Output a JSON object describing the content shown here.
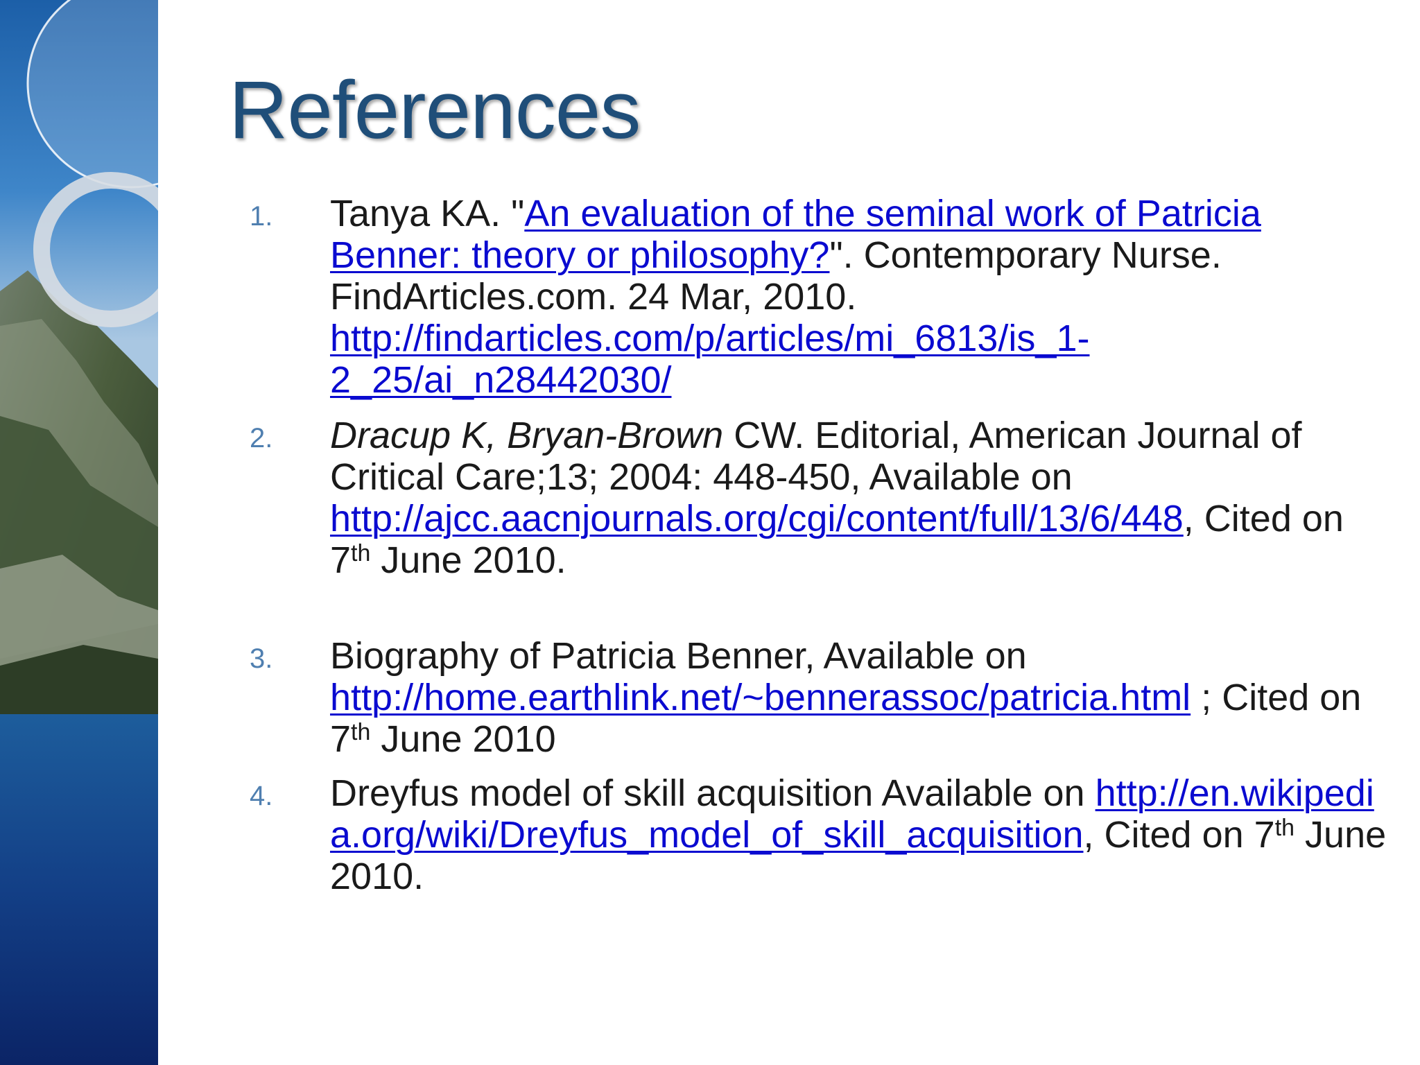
{
  "title": "References",
  "references": [
    {
      "number": "1.",
      "pre": "Tanya KA. \"",
      "link_title": "An evaluation of the seminal work of Patricia Benner: theory or philosophy?",
      "mid": "\". Contemporary Nurse. FindArticles.com. 24 Mar, 2010. ",
      "url": "http://findarticles.com/p/articles/mi_6813/is_1-2_25/ai_n28442030/"
    },
    {
      "number": "2.",
      "authors_italic": "Dracup K, Bryan-Brown",
      "text": " CW. Editorial, American Journal of Critical Care;13; 2004: 448-450,  Available on ",
      "url": "http://ajcc.aacnjournals.org/cgi/content/full/13/6/448",
      "after_url": ", Cited on 7",
      "sup": "th",
      "tail": " June 2010."
    },
    {
      "number": "3.",
      "text": "Biography of Patricia Benner, Available on ",
      "url": "http://home.earthlink.net/~bennerassoc/patricia.html",
      "after_url": " ; Cited on 7",
      "sup": "th",
      "tail": " June 2010"
    },
    {
      "number": "4.",
      "text": "Dreyfus model of skill acquisition Available on ",
      "url": "http://en.wikipedia.org/wiki/Dreyfus_model_of_skill_acquisition",
      "after_url": ", Cited on 7",
      "sup": "th",
      "tail": " June 2010."
    }
  ],
  "colors": {
    "title": "#1f4e79",
    "link": "#0a0ad0",
    "number": "#4f7fb0",
    "body_text": "#1a1a1a"
  }
}
